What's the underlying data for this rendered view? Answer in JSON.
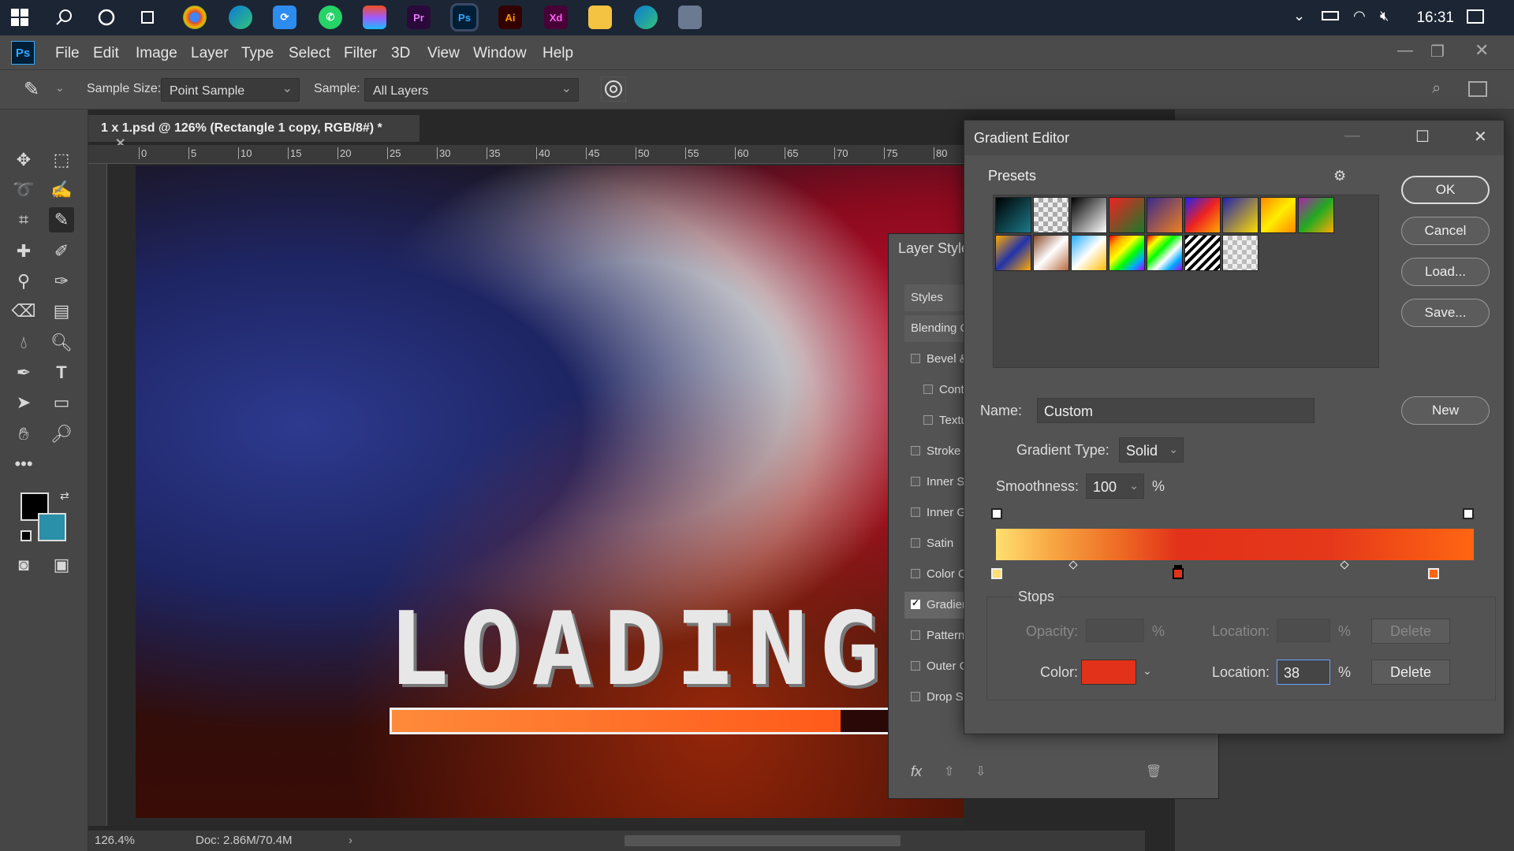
{
  "taskbar": {
    "time": "16:31"
  },
  "menu": [
    "File",
    "Edit",
    "Image",
    "Layer",
    "Type",
    "Select",
    "Filter",
    "3D",
    "View",
    "Window",
    "Help"
  ],
  "options": {
    "sample_size_label": "Sample Size:",
    "sample_size_value": "Point Sample",
    "sample_label": "Sample:",
    "sample_value": "All Layers"
  },
  "document": {
    "tab_title": "1 x 1.psd @ 126% (Rectangle 1 copy, RGB/8#) *",
    "artwork_text": "LOADING...",
    "progress": 0.82,
    "ruler_h": [
      "0",
      "5",
      "10",
      "15",
      "20",
      "25",
      "30",
      "35",
      "40",
      "45",
      "50",
      "55",
      "60",
      "65",
      "70",
      "75",
      "80"
    ]
  },
  "status": {
    "zoom": "126.4%",
    "doc": "Doc: 2.86M/70.4M"
  },
  "layer_style": {
    "title": "Layer Style",
    "items": [
      {
        "label": "Styles",
        "checkbox": false,
        "checked": false
      },
      {
        "label": "Blending O",
        "checkbox": false,
        "checked": false
      },
      {
        "label": "Bevel &",
        "checkbox": true,
        "checked": false
      },
      {
        "label": "Conto",
        "checkbox": true,
        "checked": false
      },
      {
        "label": "Textu",
        "checkbox": true,
        "checked": false
      },
      {
        "label": "Stroke",
        "checkbox": true,
        "checked": false
      },
      {
        "label": "Inner S",
        "checkbox": true,
        "checked": false
      },
      {
        "label": "Inner G",
        "checkbox": true,
        "checked": false
      },
      {
        "label": "Satin",
        "checkbox": true,
        "checked": false
      },
      {
        "label": "Color O",
        "checkbox": true,
        "checked": false
      },
      {
        "label": "Gradien",
        "checkbox": true,
        "checked": true
      },
      {
        "label": "Pattern",
        "checkbox": true,
        "checked": false
      },
      {
        "label": "Outer G",
        "checkbox": true,
        "checked": false
      },
      {
        "label": "Drop Sh",
        "checkbox": true,
        "checked": false
      }
    ]
  },
  "gradient_editor": {
    "title": "Gradient Editor",
    "presets_label": "Presets",
    "buttons": {
      "ok": "OK",
      "cancel": "Cancel",
      "load": "Load...",
      "save": "Save...",
      "new": "New"
    },
    "name_label": "Name:",
    "name_value": "Custom",
    "gradient_type_label": "Gradient Type:",
    "gradient_type_value": "Solid",
    "smoothness_label": "Smoothness:",
    "smoothness_value": "100",
    "percent": "%",
    "stops_label": "Stops",
    "opacity_label": "Opacity:",
    "location_label": "Location:",
    "color_label": "Color:",
    "location_value": "38",
    "delete_label": "Delete",
    "selected_color": "#e2321a"
  }
}
